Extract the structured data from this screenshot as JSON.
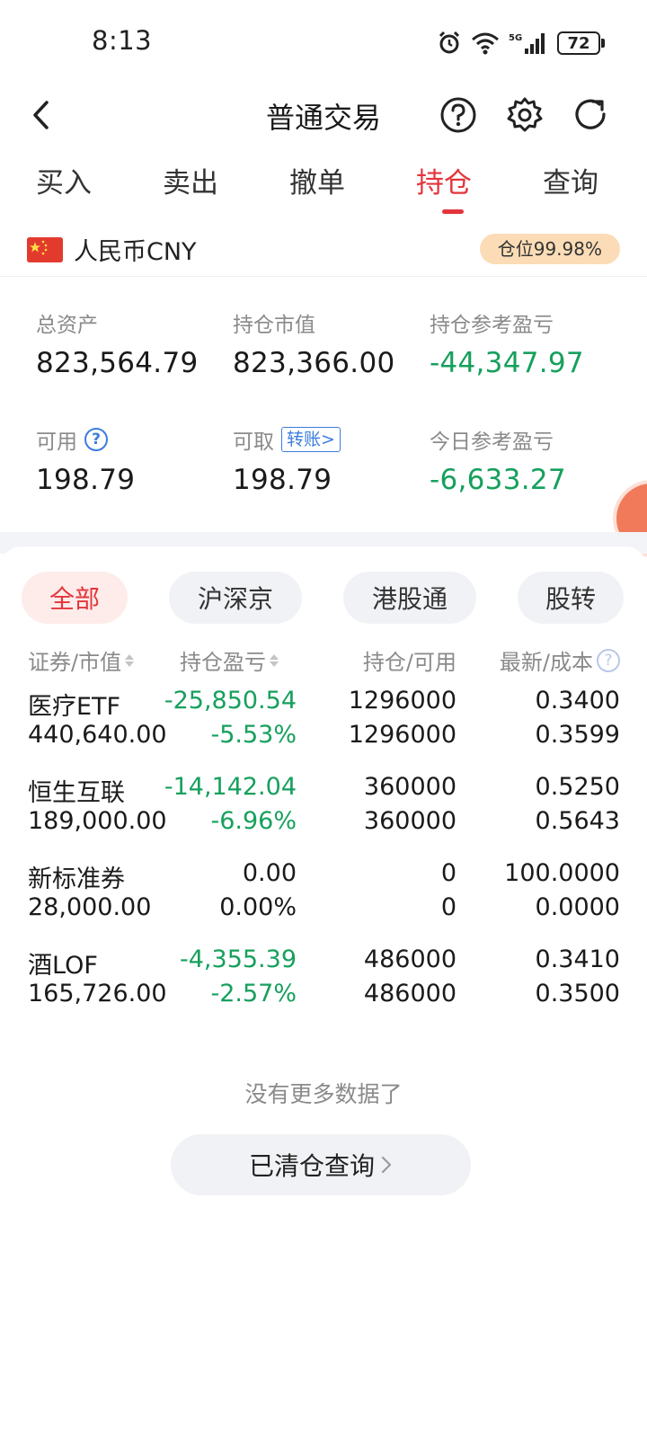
{
  "status_bar": {
    "time": "8:13",
    "battery": "72",
    "network": "5G"
  },
  "header": {
    "title": "普通交易"
  },
  "tabs": [
    {
      "label": "买入",
      "active": false
    },
    {
      "label": "卖出",
      "active": false
    },
    {
      "label": "撤单",
      "active": false
    },
    {
      "label": "持仓",
      "active": true
    },
    {
      "label": "查询",
      "active": false
    }
  ],
  "currency": {
    "label": "人民币CNY",
    "position_badge": "仓位99.98%"
  },
  "summary": {
    "total_assets": {
      "label": "总资产",
      "value": "823,564.79"
    },
    "market_value": {
      "label": "持仓市值",
      "value": "823,366.00"
    },
    "position_pl": {
      "label": "持仓参考盈亏",
      "value": "-44,347.97"
    },
    "available": {
      "label": "可用",
      "value": "198.79"
    },
    "withdrawable": {
      "label": "可取",
      "value": "198.79",
      "transfer": "转账>"
    },
    "today_pl": {
      "label": "今日参考盈亏",
      "value": "-6,633.27"
    }
  },
  "filters": [
    {
      "label": "全部",
      "active": true
    },
    {
      "label": "沪深京",
      "active": false
    },
    {
      "label": "港股通",
      "active": false
    },
    {
      "label": "股转",
      "active": false
    }
  ],
  "table": {
    "headers": {
      "security": "证券/市值",
      "pl": "持仓盈亏",
      "holdings": "持仓/可用",
      "price": "最新/成本"
    },
    "rows": [
      {
        "name": "医疗ETF",
        "market_value": "440,640.00",
        "pl": "-25,850.54",
        "pl_pct": "-5.53%",
        "holding": "1296000",
        "available": "1296000",
        "latest": "0.3400",
        "cost": "0.3599",
        "loss": true
      },
      {
        "name": "恒生互联",
        "market_value": "189,000.00",
        "pl": "-14,142.04",
        "pl_pct": "-6.96%",
        "holding": "360000",
        "available": "360000",
        "latest": "0.5250",
        "cost": "0.5643",
        "loss": true
      },
      {
        "name": "新标准券",
        "market_value": "28,000.00",
        "pl": "0.00",
        "pl_pct": "0.00%",
        "holding": "0",
        "available": "0",
        "latest": "100.0000",
        "cost": "0.0000",
        "loss": false
      },
      {
        "name": "酒LOF",
        "market_value": "165,726.00",
        "pl": "-4,355.39",
        "pl_pct": "-2.57%",
        "holding": "486000",
        "available": "486000",
        "latest": "0.3410",
        "cost": "0.3500",
        "loss": true
      }
    ]
  },
  "footer": {
    "no_more": "没有更多数据了",
    "cleared_button": "已清仓查询"
  },
  "colors": {
    "accent": "#e3353b",
    "loss": "#16a05d",
    "link": "#3b7ddd",
    "badge_bg": "#fbdcb6"
  }
}
